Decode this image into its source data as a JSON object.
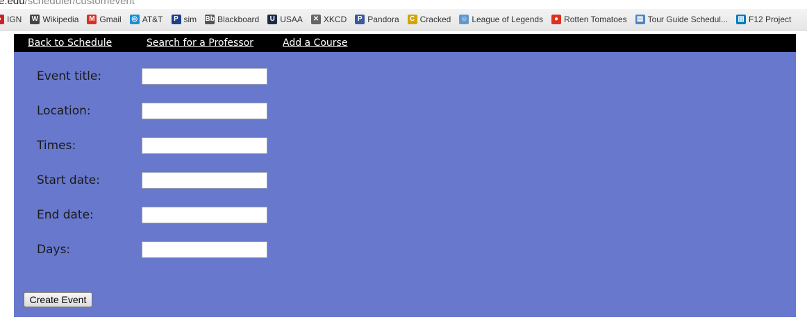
{
  "browser": {
    "url_host": "e.edu",
    "url_path": "/scheduler/customevent",
    "bookmarks": [
      {
        "label": "IGN",
        "icon": "ign-icon",
        "color": "#cc2222",
        "glyph": "●"
      },
      {
        "label": "Wikipedia",
        "icon": "wikipedia-icon",
        "color": "#444444",
        "glyph": "W"
      },
      {
        "label": "Gmail",
        "icon": "gmail-icon",
        "color": "#d93025",
        "glyph": "M"
      },
      {
        "label": "AT&T",
        "icon": "att-icon",
        "color": "#1b8ed6",
        "glyph": "◎"
      },
      {
        "label": "sim",
        "icon": "pearson-p-icon",
        "color": "#1d3f8a",
        "glyph": "P"
      },
      {
        "label": "Blackboard",
        "icon": "blackboard-icon",
        "color": "#555555",
        "glyph": "Bb"
      },
      {
        "label": "USAA",
        "icon": "usaa-icon",
        "color": "#1c2a4a",
        "glyph": "U"
      },
      {
        "label": "XKCD",
        "icon": "xkcd-icon",
        "color": "#666666",
        "glyph": "✕"
      },
      {
        "label": "Pandora",
        "icon": "pandora-icon",
        "color": "#3a5aa0",
        "glyph": "P"
      },
      {
        "label": "Cracked",
        "icon": "cracked-icon",
        "color": "#d4a400",
        "glyph": "C"
      },
      {
        "label": "League of Legends",
        "icon": "reddit-icon",
        "color": "#5f99cf",
        "glyph": "☺"
      },
      {
        "label": "Rotten Tomatoes",
        "icon": "tomato-icon",
        "color": "#e0301e",
        "glyph": "●"
      },
      {
        "label": "Tour Guide Schedul...",
        "icon": "document-icon",
        "color": "#4a86c5",
        "glyph": "▤"
      },
      {
        "label": "F12 Project",
        "icon": "trello-icon",
        "color": "#0079bf",
        "glyph": "▥"
      }
    ]
  },
  "nav": {
    "back": "Back to Schedule",
    "search": "Search for a Professor",
    "add": "Add a Course"
  },
  "form": {
    "fields": [
      {
        "label": "Event title:",
        "value": ""
      },
      {
        "label": "Location:",
        "value": ""
      },
      {
        "label": "Times:",
        "value": ""
      },
      {
        "label": "Start date:",
        "value": ""
      },
      {
        "label": "End date:",
        "value": ""
      },
      {
        "label": "Days:",
        "value": ""
      }
    ],
    "submit_label": "Create Event"
  },
  "colors": {
    "page_background": "#6878cc",
    "nav_background": "#000000"
  }
}
